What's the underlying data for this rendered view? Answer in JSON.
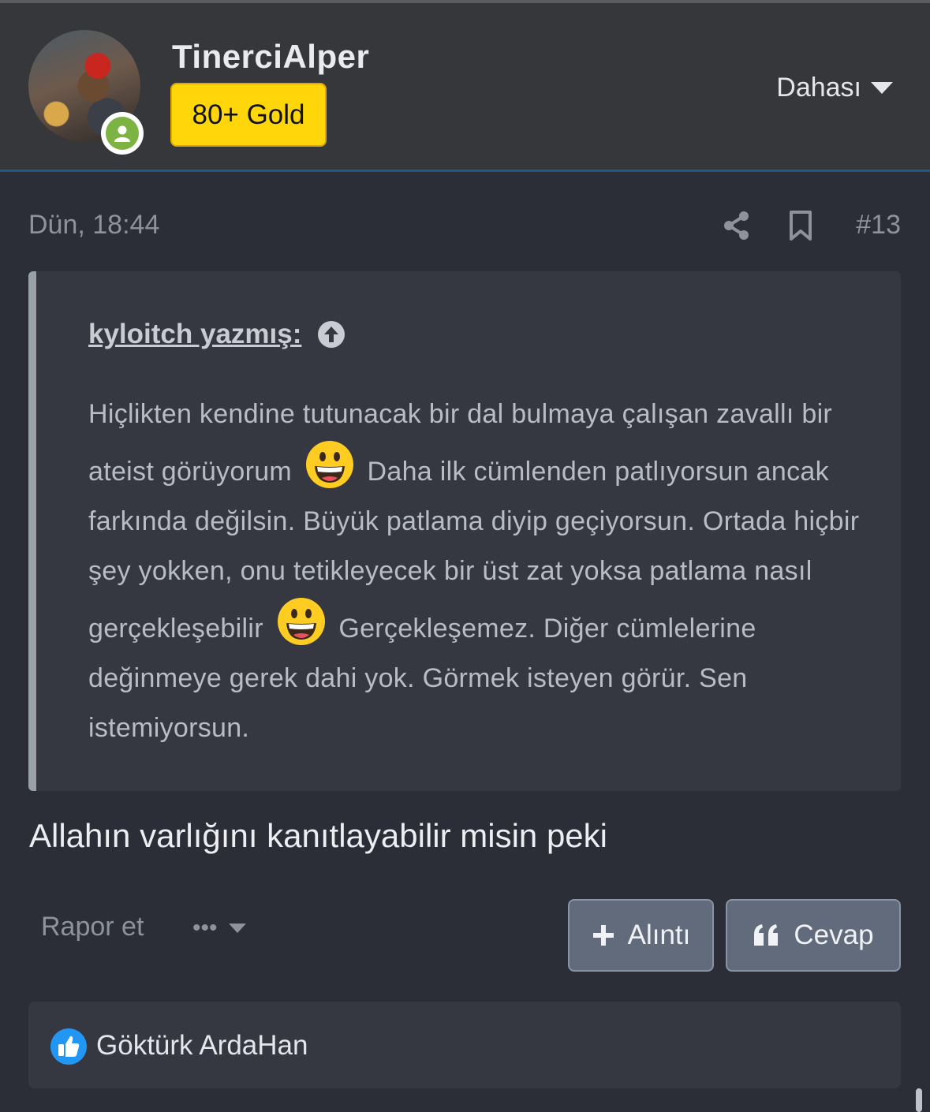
{
  "user": {
    "name": "TinerciAlper",
    "rank": "80+ Gold",
    "status": "online",
    "avatar_icon": "user-avatar"
  },
  "header": {
    "more_label": "Dahası"
  },
  "post": {
    "date": "Dün, 18:44",
    "number": "#13",
    "quote": {
      "author_line": "kyloitch yazmış:",
      "segments": [
        "Hiçlikten kendine tutunacak bir dal bulmaya çalışan zavallı bir ateist görüyorum",
        "Daha ilk cümlenden patlıyorsun ancak farkında değilsin. Büyük patlama diyip geçiyorsun. Ortada hiçbir şey yokken, onu tetikleyecek bir üst zat yoksa patlama nasıl gerçekleşebilir",
        "Gerçekleşemez. Diğer cümlelerine değinmeye gerek dahi yok. Görmek isteyen görür. Sen istemiyorsun."
      ],
      "emoji": "grinning-face"
    },
    "message": "Allahın varlığını kanıtlayabilir misin peki"
  },
  "actions": {
    "report": "Rapor et",
    "more_dots": "•••",
    "quote_button": "Alıntı",
    "reply_button": "Cevap"
  },
  "reactions": {
    "type": "like",
    "users": "Göktürk ArdaHan"
  },
  "colors": {
    "accent": "#1c5a84",
    "rank_badge": "#ffd60a",
    "online": "#7cb342",
    "like": "#2196f3"
  }
}
